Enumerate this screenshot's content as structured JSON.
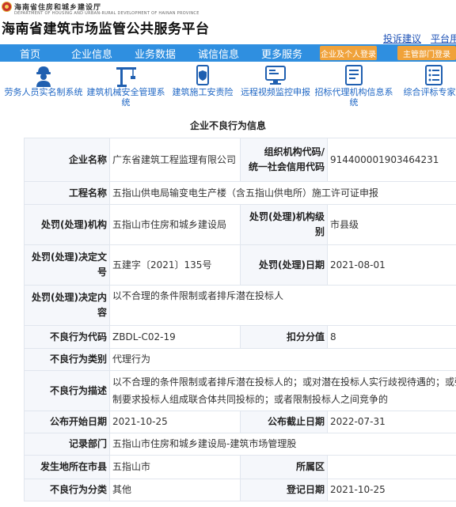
{
  "header": {
    "dept_name": "海南省住房和城乡建设厅",
    "dept_subtitle": "DEPARTMENT OF HOUSING AND URBAN-RURAL DEVELOPMENT OF HAINAN PROVINCE",
    "site_title": "海南省建筑市场监管公共服务平台",
    "links": [
      "投诉建议",
      "平台用"
    ]
  },
  "nav": {
    "items": [
      "首页",
      "企业信息",
      "业务数据",
      "诚信信息",
      "更多服务"
    ],
    "login_button": "企业及个人登录",
    "dept_button": "主管部门登录"
  },
  "icons": [
    {
      "label": "劳务人员实名制系统",
      "icon": "worker-icon"
    },
    {
      "label": "建筑机械安全管理系统",
      "icon": "crane-icon"
    },
    {
      "label": "建筑施工安责险",
      "icon": "shield-icon"
    },
    {
      "label": "远程视频监控申报",
      "icon": "monitor-icon"
    },
    {
      "label": "招标代理机构信息系统",
      "icon": "document-icon"
    },
    {
      "label": "综合评标专家库",
      "icon": "list-icon"
    }
  ],
  "section_title": "企业不良行为信息",
  "record": {
    "company_label": "企业名称",
    "company": "广东省建筑工程监理有限公司",
    "org_code_label_1": "组织机构代码/",
    "org_code_label_2": "统一社会信用代码",
    "org_code": "914400001903464231",
    "project_label": "工程名称",
    "project": "五指山供电局输变电生产楼（含五指山供电所）施工许可证申报",
    "authority_label": "处罚(处理)机构",
    "authority": "五指山市住房和城乡建设局",
    "authority_level_label": "处罚(处理)机构级别",
    "authority_level": "市县级",
    "decision_no_label": "处罚(处理)决定文号",
    "decision_no": "五建字〔2021〕135号",
    "decision_date_label": "处罚(处理)日期",
    "decision_date": "2021-08-01",
    "decision_content_label": "处罚(处理)决定内容",
    "decision_content": "以不合理的条件限制或者排斥潜在投标人",
    "code_label": "不良行为代码",
    "code": "ZBDL-C02-19",
    "points_label": "扣分分值",
    "points": "8",
    "category_label": "不良行为类别",
    "category": "代理行为",
    "desc_label": "不良行为描述",
    "desc": "以不合理的条件限制或者排斥潜在投标人的；或对潜在投标人实行歧视待遇的；或强制要求投标人组成联合体共同投标的；或者限制投标人之间竞争的",
    "publish_start_label": "公布开始日期",
    "publish_start": "2021-10-25",
    "publish_end_label": "公布截止日期",
    "publish_end": "2022-07-31",
    "record_dept_label": "记录部门",
    "record_dept": "五指山市住房和城乡建设局-建筑市场管理股",
    "city_label": "发生地所在市县",
    "city": "五指山市",
    "district_label": "所属区",
    "district": "",
    "class_label": "不良行为分类",
    "class": "其他",
    "reg_date_label": "登记日期",
    "reg_date": "2021-10-25"
  }
}
